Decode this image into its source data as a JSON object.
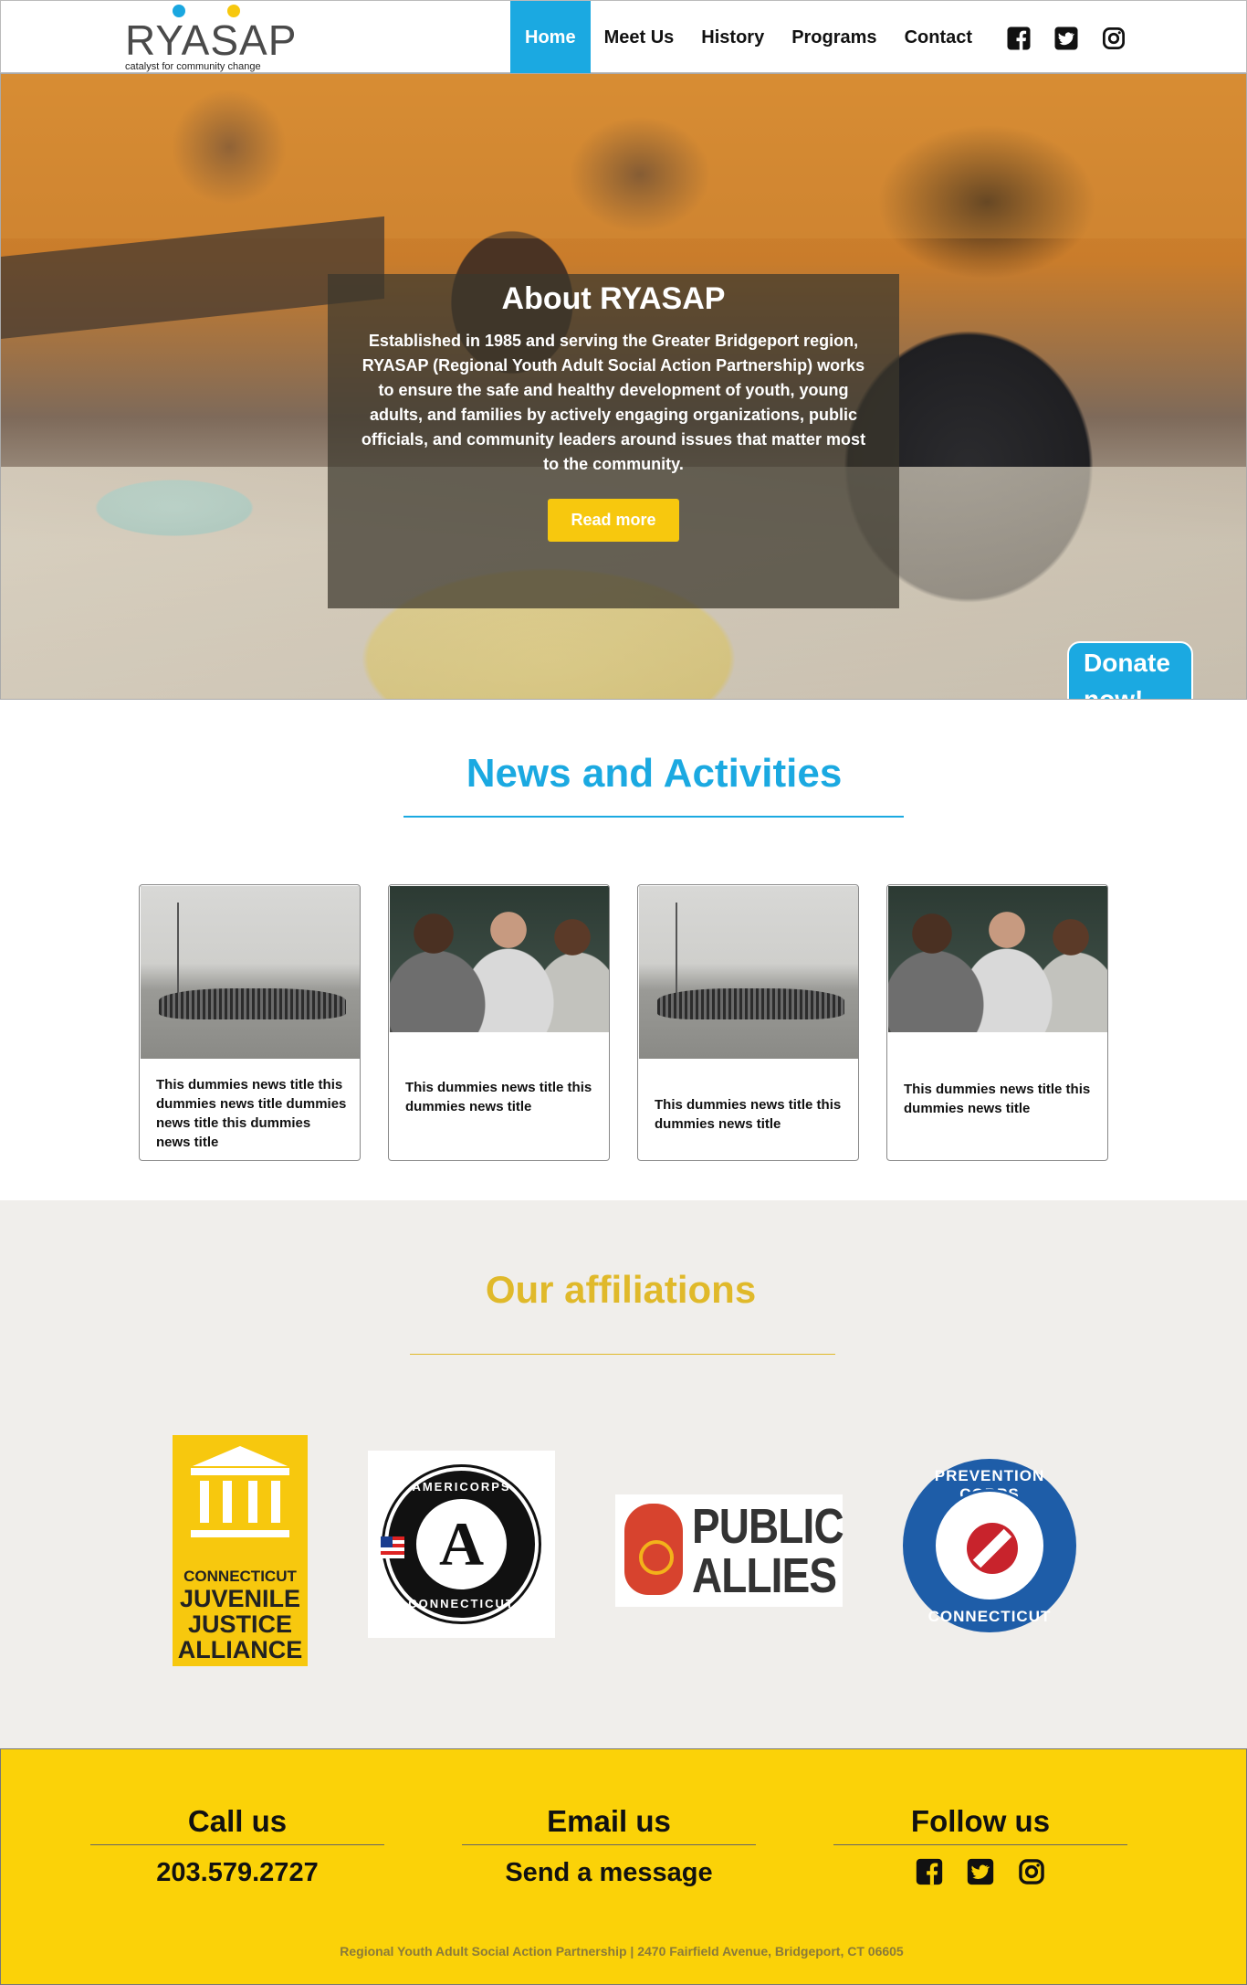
{
  "brand": {
    "name": "RYASAP",
    "tagline": "catalyst for community change"
  },
  "nav": {
    "items": [
      "Home",
      "Meet Us",
      "History",
      "Programs",
      "Contact"
    ],
    "active": "Home"
  },
  "hero": {
    "title": "About RYASAP",
    "text": "Established in 1985 and serving the Greater Bridgeport region, RYASAP (Regional Youth Adult Social Action Partnership) works to ensure the safe and healthy development of youth, young adults, and families by actively engaging organizations, public officials, and community leaders around issues that matter most to the community.",
    "button": "Read more",
    "donate_line1": "Donate",
    "donate_line2": "now!"
  },
  "news": {
    "title": "News and Activities",
    "cards": [
      {
        "title": "This dummies news title this dummies news title dummies news title this dummies news title"
      },
      {
        "title": "This dummies news title this dummies news title"
      },
      {
        "title": "This dummies news title this dummies news title"
      },
      {
        "title": "This dummies news title this dummies news title"
      }
    ]
  },
  "affiliations": {
    "title": "Our affiliations",
    "cjja": [
      "CONNECTICUT",
      "JUVENILE",
      "JUSTICE",
      "ALLIANCE"
    ],
    "americorps": {
      "top": "AMERICORPS",
      "letter": "A",
      "bottom": "CONNECTICUT"
    },
    "public_allies": [
      "PUBLIC",
      "ALLIES"
    ],
    "prevention_corps": {
      "top": "PREVENTION CORPS",
      "bottom": "CONNECTICUT"
    }
  },
  "footer": {
    "call_title": "Call us",
    "phone": "203.579.2727",
    "email_title": "Email us",
    "email_link": "Send a message",
    "follow_title": "Follow us",
    "address": "Regional Youth Adult Social Action Partnership | 2470 Fairfield Avenue, Bridgeport, CT 06605"
  },
  "colors": {
    "accent_blue": "#1ba9e1",
    "accent_yellow": "#fbd208",
    "gold_text": "#e0b92a"
  },
  "icons": [
    "facebook-icon",
    "twitter-icon",
    "instagram-icon"
  ]
}
